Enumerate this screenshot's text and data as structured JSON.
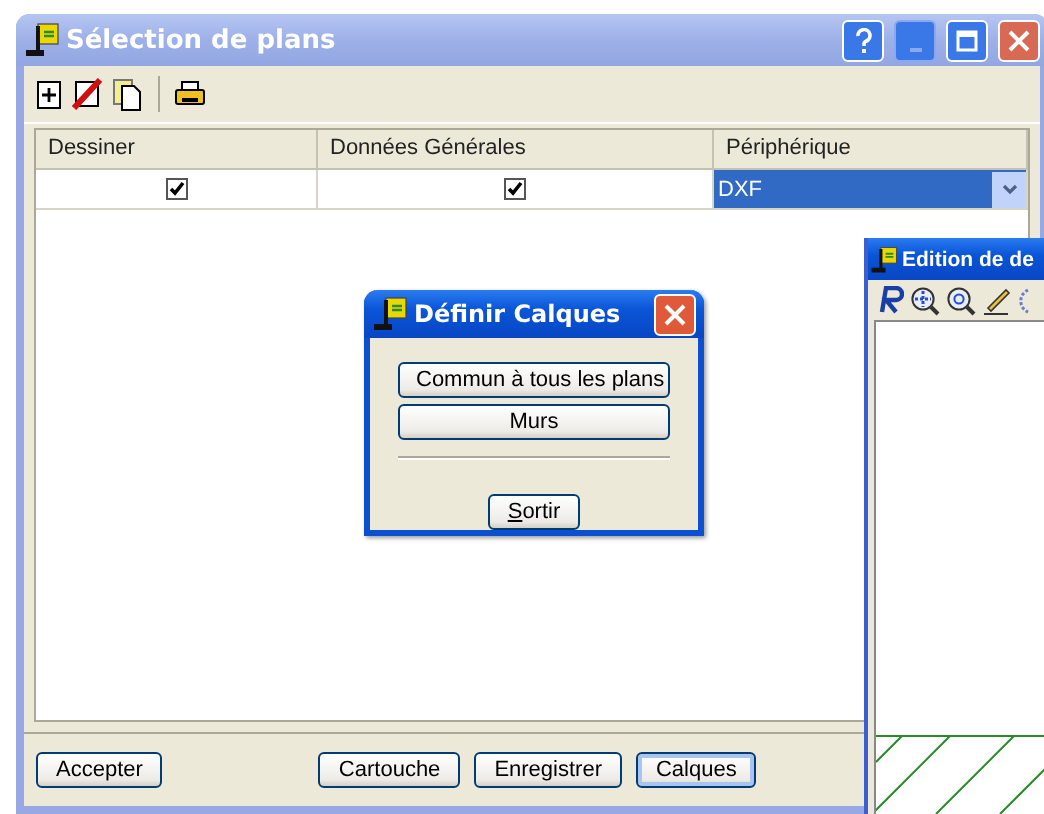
{
  "main_window": {
    "title": "Sélection de plans",
    "active": false
  },
  "table": {
    "columns": [
      "Dessiner",
      "Données Générales",
      "Périphérique"
    ],
    "rows": [
      {
        "cells": [
          {
            "kind": "checkbox",
            "checked": true
          },
          {
            "kind": "checkbox",
            "checked": true
          },
          {
            "kind": "dropdown",
            "value": "DXF",
            "selected": true
          }
        ]
      }
    ]
  },
  "buttons": [
    {
      "label": "Accepter"
    },
    {
      "label": "Cartouche"
    },
    {
      "label": "Enregistrer"
    },
    {
      "label": "Calques",
      "focused": true
    }
  ],
  "edit_window": {
    "title": "Edition de de",
    "active": true
  },
  "dialog": {
    "title": "Définir Calques",
    "active": true,
    "buttons": [
      "Commun à tous les plans",
      "Murs"
    ],
    "exit_button": "Sortir"
  }
}
